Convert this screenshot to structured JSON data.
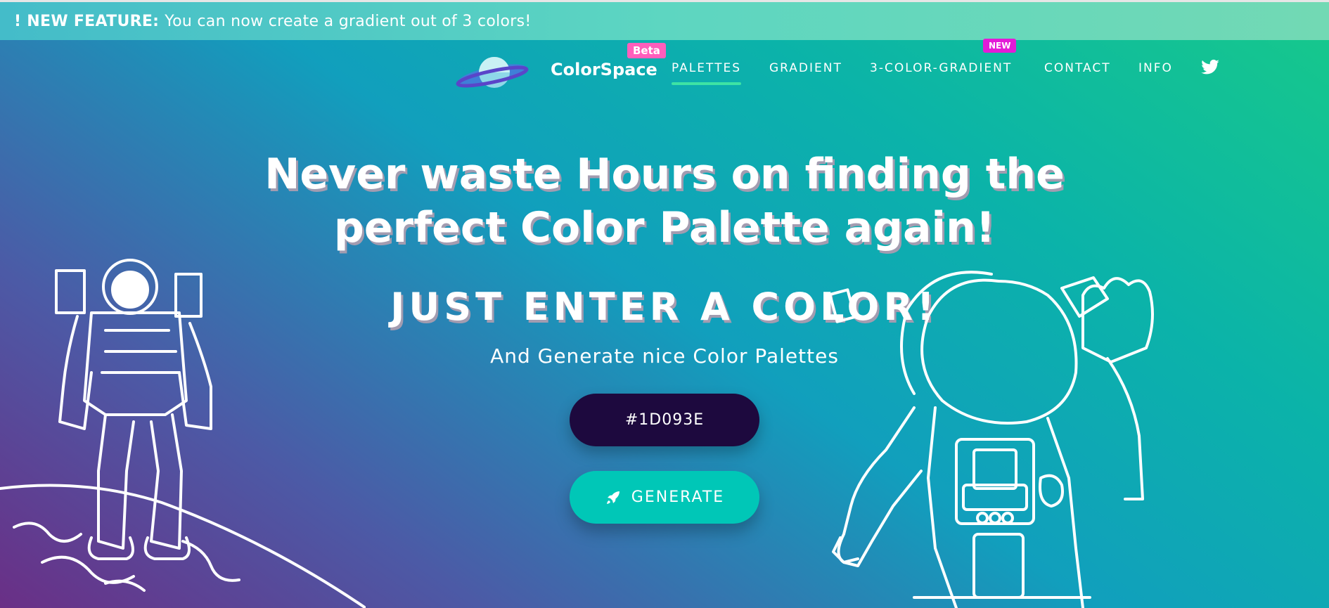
{
  "banner": {
    "label": "! NEW FEATURE:",
    "text": "You can now create a gradient out of 3 colors!"
  },
  "nav": {
    "brand": "ColorSpace",
    "beta_badge": "Beta",
    "new_badge": "NEW",
    "items": [
      {
        "label": "PALETTES",
        "active": true
      },
      {
        "label": "GRADIENT",
        "active": false
      },
      {
        "label": "3-COLOR-GRADIENT",
        "active": false
      },
      {
        "label": "CONTACT",
        "active": false
      },
      {
        "label": "INFO",
        "active": false
      }
    ],
    "twitter_icon": "twitter-icon"
  },
  "hero": {
    "headline_line1": "Never waste Hours on finding the",
    "headline_line2": "perfect Color Palette again!",
    "subheadline": "JUST ENTER A COLOR!",
    "tagline": "And Generate nice Color Palettes",
    "color_input_value": "#1D093E",
    "generate_label": "GENERATE",
    "generate_icon": "rocket-icon"
  },
  "colors": {
    "input_bg": "#1d093e",
    "generate_bg": "#00c7b7",
    "active_underline": "#3de3a4",
    "beta_badge": "#ff5ebc",
    "new_badge": "#e31bd7"
  }
}
